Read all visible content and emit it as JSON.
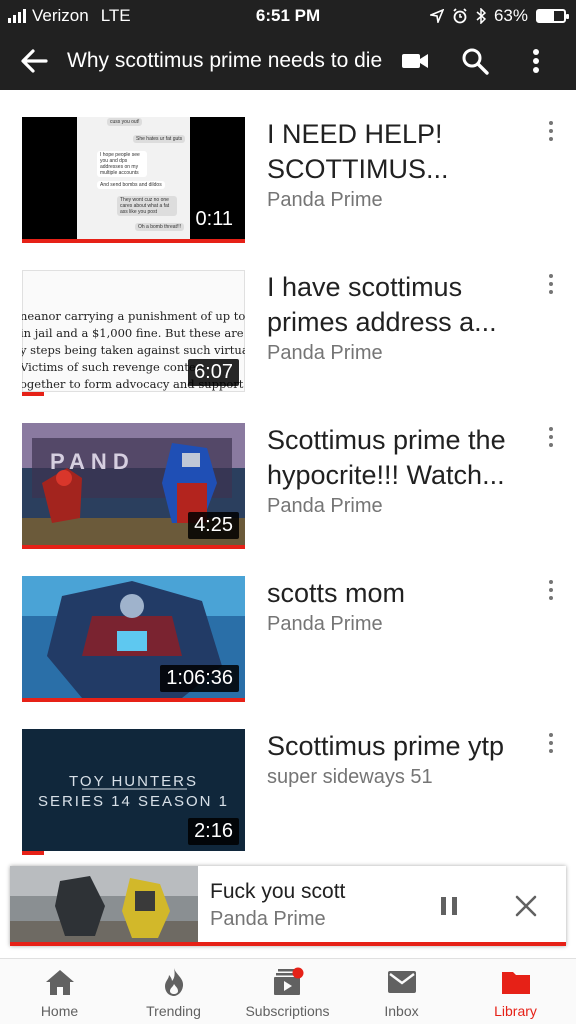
{
  "status_bar": {
    "carrier": "Verizon",
    "network": "LTE",
    "time": "6:51 PM",
    "battery": "63%",
    "battery_level": 0.63,
    "icons": [
      "location-icon",
      "alarm-icon",
      "bluetooth-icon",
      "battery-icon"
    ]
  },
  "app_bar": {
    "title": "Why scottimus prime needs to die",
    "icons": [
      "back-arrow-icon",
      "video-camera-icon",
      "search-icon",
      "more-vert-icon"
    ]
  },
  "videos": [
    {
      "title": "I NEED HELP! SCOTTIMUS...",
      "channel": "Panda Prime",
      "duration": "0:11",
      "watched_fraction": 1.0,
      "thumbnail_texts": [
        "cuss you out!",
        "She hates ur fat guts",
        "I hope people see you and dps addresses on my multiple accounts",
        "And send bombs and dildos",
        "They wont cuz no one cares about what a fat ass like you post",
        "Oh a bomb threat!!!"
      ]
    },
    {
      "title": "I have scottimus primes address a...",
      "channel": "Panda Prime",
      "duration": "6:07",
      "watched_fraction": 0.1,
      "thumbnail_texts": [
        "neanor carrying a punishment of up to six",
        "in jail and a $1,000 fine. But these are no",
        "y steps being taken against such virtual",
        "Victims of such revenge conten",
        "ogether to form advocacy and support"
      ]
    },
    {
      "title": "Scottimus prime the hypocrite!!! Watch...",
      "channel": "Panda Prime",
      "duration": "4:25",
      "watched_fraction": 1.0,
      "thumbnail_texts": [
        "PAND"
      ]
    },
    {
      "title": "scotts mom",
      "channel": "Panda Prime",
      "duration": "1:06:36",
      "watched_fraction": 1.0,
      "thumbnail_texts": []
    },
    {
      "title": "Scottimus prime ytp",
      "channel": "super sideways 51",
      "duration": "2:16",
      "watched_fraction": 0.1,
      "thumbnail_texts": [
        "TOY HUNTERS",
        "SERIES 14 SEASON 1"
      ]
    }
  ],
  "mini_player": {
    "title": "Fuck you scott",
    "channel": "Panda Prime",
    "icons": [
      "pause-icon",
      "close-icon"
    ]
  },
  "bottom_nav": [
    {
      "label": "Home",
      "icon": "home-icon",
      "active": false
    },
    {
      "label": "Trending",
      "icon": "flame-icon",
      "active": false
    },
    {
      "label": "Subscriptions",
      "icon": "subscriptions-icon",
      "active": false
    },
    {
      "label": "Inbox",
      "icon": "inbox-icon",
      "active": false
    },
    {
      "label": "Library",
      "icon": "folder-icon",
      "active": true
    }
  ],
  "colors": {
    "header_bg": "#212121",
    "accent": "#e62117",
    "secondary_text": "#757575"
  }
}
